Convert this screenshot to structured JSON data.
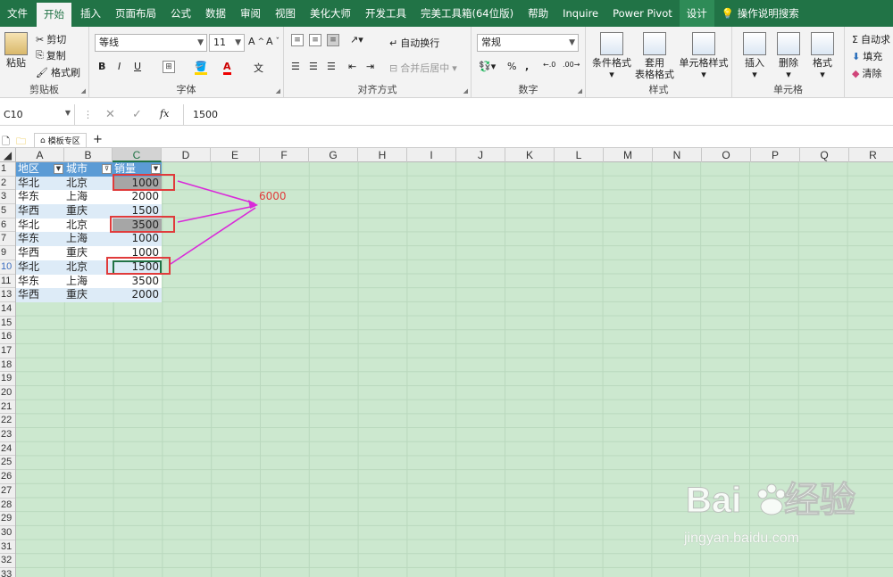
{
  "tabs": [
    "文件",
    "开始",
    "插入",
    "页面布局",
    "公式",
    "数据",
    "审阅",
    "视图",
    "美化大师",
    "开发工具",
    "完美工具箱(64位版)",
    "帮助",
    "Inquire",
    "Power Pivot",
    "设计",
    "操作说明搜索"
  ],
  "clipboard": {
    "paste": "粘贴",
    "cut": "剪切",
    "copy": "复制",
    "format_painter": "格式刷",
    "label": "剪贴板"
  },
  "font": {
    "name": "等线",
    "size": "11",
    "label": "字体",
    "bold": "B",
    "italic": "I",
    "underline": "U"
  },
  "alignment": {
    "wrap": "自动换行",
    "merge": "合并后居中",
    "label": "对齐方式"
  },
  "number": {
    "format": "常规",
    "label": "数字",
    "percent": "%",
    "comma": ","
  },
  "styles": {
    "conditional": "条件格式",
    "table_format": "套用\n表格格式",
    "cell_style": "单元格样式",
    "label": "样式"
  },
  "cells": {
    "insert": "插入",
    "delete": "删除",
    "format": "格式",
    "label": "单元格"
  },
  "editing": {
    "autosum": "自动求",
    "fill": "填充",
    "clear": "清除"
  },
  "formula_bar": {
    "name_box": "C10",
    "value": "1500",
    "fx": "fx"
  },
  "tab_bar": {
    "template": "模板专区",
    "add": "+"
  },
  "columns": [
    "A",
    "B",
    "C",
    "D",
    "E",
    "F",
    "G",
    "H",
    "I",
    "J",
    "K",
    "L",
    "M",
    "N",
    "O",
    "P",
    "Q",
    "R"
  ],
  "rows": [
    "1",
    "2",
    "3",
    "5",
    "6",
    "7",
    "9",
    "10",
    "11",
    "13",
    "14",
    "15",
    "16",
    "17",
    "18",
    "19",
    "20",
    "21",
    "22",
    "23",
    "24",
    "25",
    "26",
    "27",
    "28",
    "29",
    "30",
    "31",
    "32",
    "33"
  ],
  "table": {
    "headers": [
      "地区",
      "城市",
      "销量"
    ],
    "data": [
      [
        "华北",
        "北京",
        "1000"
      ],
      [
        "华东",
        "上海",
        "2000"
      ],
      [
        "华西",
        "重庆",
        "1500"
      ],
      [
        "华北",
        "北京",
        "3500"
      ],
      [
        "华东",
        "上海",
        "1000"
      ],
      [
        "华西",
        "重庆",
        "1000"
      ],
      [
        "华北",
        "北京",
        "1500"
      ],
      [
        "华东",
        "上海",
        "3500"
      ],
      [
        "华西",
        "重庆",
        "2000"
      ]
    ]
  },
  "annotation": {
    "sum": "6000"
  },
  "colors": {
    "excel_green": "#217346",
    "sheet_bg": "#cce8cf",
    "header_blue": "#5b9bd5",
    "band": "#ddebf7",
    "highlight_red": "#e03b3b",
    "arrow_magenta": "#d92ad9"
  },
  "watermark": {
    "brand": "Bai du 经验",
    "url": "jingyan.baidu.com"
  }
}
